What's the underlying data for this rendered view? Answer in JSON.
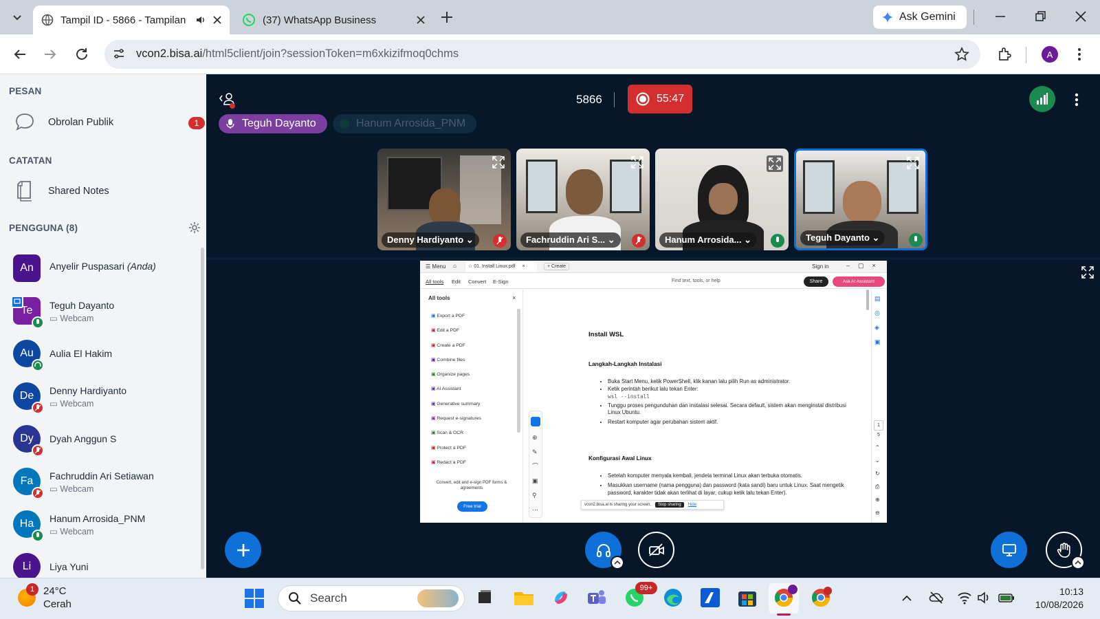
{
  "browser": {
    "tabs": [
      {
        "title": "Tampil ID - 5866 - Tampilan",
        "active": true
      },
      {
        "title": "(37) WhatsApp Business",
        "active": false
      }
    ],
    "gemini_label": "Ask Gemini",
    "url_host": "vcon2.bisa.ai",
    "url_path": "/html5client/join?sessionToken=m6xkizifmoq0chms",
    "profile_initial": "A"
  },
  "sidebar": {
    "messages_header": "PESAN",
    "public_chat": {
      "label": "Obrolan Publik",
      "badge": "1"
    },
    "notes_header": "CATATAN",
    "shared_notes": {
      "label": "Shared Notes"
    },
    "users_header": "PENGGUNA (8)",
    "users": [
      {
        "initials": "An",
        "name": "Anyelir Puspasari",
        "suffix": "(Anda)",
        "sub": "",
        "color": "#4a148c"
      },
      {
        "initials": "Te",
        "name": "Teguh Dayanto",
        "suffix": "",
        "sub": "Webcam",
        "color": "#7b1fa2"
      },
      {
        "initials": "Au",
        "name": "Aulia El Hakim",
        "suffix": "",
        "sub": "",
        "color": "#0d47a1"
      },
      {
        "initials": "De",
        "name": "Denny Hardiyanto",
        "suffix": "",
        "sub": "Webcam",
        "color": "#0d47a1"
      },
      {
        "initials": "Dy",
        "name": "Dyah Anggun S",
        "suffix": "",
        "sub": "",
        "color": "#283593"
      },
      {
        "initials": "Fa",
        "name": "Fachruddin Ari Setiawan",
        "suffix": "",
        "sub": "Webcam",
        "color": "#0277bd"
      },
      {
        "initials": "Ha",
        "name": "Hanum Arrosida_PNM",
        "suffix": "",
        "sub": "Webcam",
        "color": "#0277bd"
      },
      {
        "initials": "Li",
        "name": "Liya Yuni",
        "suffix": "",
        "sub": "",
        "color": "#4a148c"
      }
    ]
  },
  "meeting": {
    "room_id": "5866",
    "timer": "55:47",
    "talkers": [
      {
        "name": "Teguh Dayanto",
        "active": true
      },
      {
        "name": "Hanum Arrosida_PNM",
        "active": false
      }
    ],
    "tiles": [
      {
        "name": "Denny Hardiyanto"
      },
      {
        "name": "Fachruddin Ari S..."
      },
      {
        "name": "Hanum Arrosida..."
      },
      {
        "name": "Teguh Dayanto"
      }
    ]
  },
  "shared_screen": {
    "tab_label": "01. Install Linux.pdf",
    "new_tab": "Create",
    "menu_label": "Menu",
    "sign_in": "Sign in",
    "toolbar_tabs": [
      "All tools",
      "Edit",
      "Convert",
      "E-Sign"
    ],
    "find_placeholder": "Find text, tools, or help",
    "share_label": "Share",
    "ask_ai": "Ask AI Assistant",
    "tools_header": "All tools",
    "tools": [
      "Export a PDF",
      "Edit a PDF",
      "Create a PDF",
      "Combine files",
      "Organize pages",
      "AI Assistant",
      "Generative summary",
      "Request e-signatures",
      "Scan & OCR",
      "Protect a PDF",
      "Redact a PDF"
    ],
    "promo_text": "Convert, edit and e-sign PDF forms & agreements",
    "promo_button": "Free trial",
    "doc_title": "Install WSL",
    "section1": "Langkah-Langkah Instalasi",
    "s1_items": [
      "Buka Start Menu, ketik PowerShell, klik kanan lalu pilih Run as administrator.",
      "Ketik perintah berikut lalu tekan Enter:",
      "Tunggu proses pengunduhan dan instalasi selesai. Secara default, sistem akan menginstal distribusi Linux Ubuntu.",
      "Restart komputer agar perubahan sistem aktif."
    ],
    "command": "wsl --install",
    "section2": "Konfigurasi Awal Linux",
    "s2_items": [
      "Setelah komputer menyala kembali, jendela terminal Linux akan terbuka otomatis.",
      "Masukkan username (nama pengguna) dan password (kata sandi) baru untuk Linux. Saat mengetik password, karakter tidak akan terlihat di layar, cukup ketik lalu tekan Enter)."
    ],
    "sharing_text": "vcon2.bisa.ai is sharing your screen.",
    "stop_sharing": "Stop sharing",
    "hide": "Hide",
    "page_number": "1",
    "page_total": "5"
  },
  "taskbar": {
    "weather_temp": "24°C",
    "weather_desc": "Cerah",
    "weather_badge": "1",
    "search_label": "Search",
    "whatsapp_badge": "99+",
    "time": "10:13",
    "date": "10/08/2026"
  },
  "colors": {
    "accent": "#0f70d7",
    "record": "#d32f2f",
    "talker": "#7b3fa0",
    "meeting_bg": "#06172a"
  }
}
